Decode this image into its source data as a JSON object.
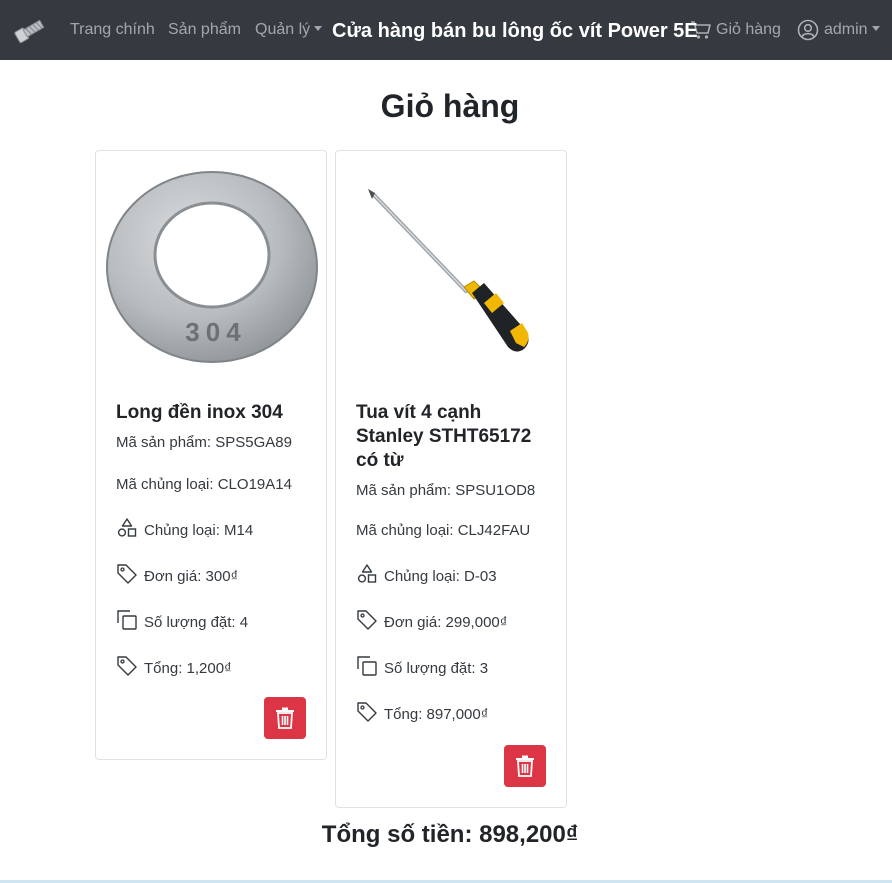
{
  "navbar": {
    "links": {
      "home": "Trang chính",
      "products": "Sản phẩm",
      "manage": "Quản lý"
    },
    "brand": "Cửa hàng bán bu lông ốc vít Power 5E",
    "cart": "Giỏ hàng",
    "user": "admin"
  },
  "page": {
    "title": "Giỏ hàng",
    "total_label": "Tổng số tiền: 898,200₫"
  },
  "cart_items": [
    {
      "name": "Long đền inox 304",
      "product_code": "Mã sản phẩm: SPS5GA89",
      "category_code": "Mã chủng loại: CLO19A14",
      "category": "Chủng loại: M14",
      "unit_price": "Đơn giá: 300₫",
      "quantity": "Số lượng đặt: 4",
      "subtotal": "Tổng: 1,200₫",
      "image_stamp": "304"
    },
    {
      "name": "Tua vít 4 cạnh Stanley STHT65172 có từ",
      "product_code": "Mã sản phẩm: SPSU1OD8",
      "category_code": "Mã chủng loại: CLJ42FAU",
      "category": "Chủng loại: D-03",
      "unit_price": "Đơn giá: 299,000₫",
      "quantity": "Số lượng đặt: 3",
      "subtotal": "Tổng: 897,000₫"
    }
  ],
  "colors": {
    "navbar_bg": "#343a40",
    "danger": "#dc3545"
  },
  "icons": {
    "logo": "bolt-icon",
    "cart": "cart-icon",
    "user": "user-circle-icon",
    "category": "shapes-icon",
    "price": "tag-icon",
    "quantity": "copy-icon",
    "delete": "trash-icon"
  }
}
